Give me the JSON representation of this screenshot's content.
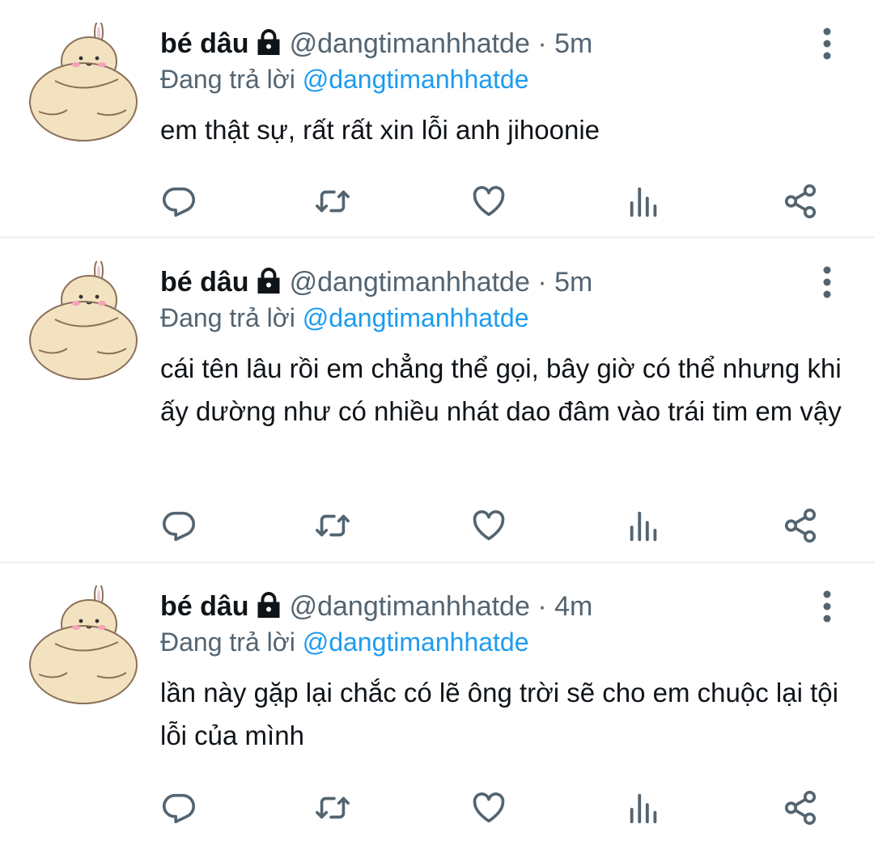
{
  "tweets": [
    {
      "name": "bé dâu",
      "handle": "@dangtimanhhatde",
      "sep": "·",
      "time": "5m",
      "reply_prefix": "Đang trả lời",
      "reply_to": "@dangtimanhhatde",
      "text": "em thật sự, rất rất xin lỗi anh jihoonie"
    },
    {
      "name": "bé dâu",
      "handle": "@dangtimanhhatde",
      "sep": "·",
      "time": "5m",
      "reply_prefix": "Đang trả lời",
      "reply_to": "@dangtimanhhatde",
      "text": "cái tên lâu rồi em chẳng thể gọi, bây giờ có thể nhưng khi ấy dường như có nhiều nhát dao đâm vào trái tim em vậy"
    },
    {
      "name": "bé dâu",
      "handle": "@dangtimanhhatde",
      "sep": "·",
      "time": "4m",
      "reply_prefix": "Đang trả lời",
      "reply_to": "@dangtimanhhatde",
      "text": "lần này gặp lại chắc có lẽ ông trời sẽ cho em chuộc lại tội lỗi của mình"
    }
  ],
  "icons": {
    "avatar": "round-bunny-avatar",
    "lock": "lock-icon",
    "more": "more-vertical-icon",
    "reply": "reply-icon",
    "retweet": "retweet-icon",
    "like": "like-icon",
    "views": "views-icon",
    "share": "share-icon"
  },
  "colors": {
    "text": "#0f1419",
    "secondary": "#536471",
    "link": "#1d9bf0",
    "divider": "#eff3f4"
  }
}
